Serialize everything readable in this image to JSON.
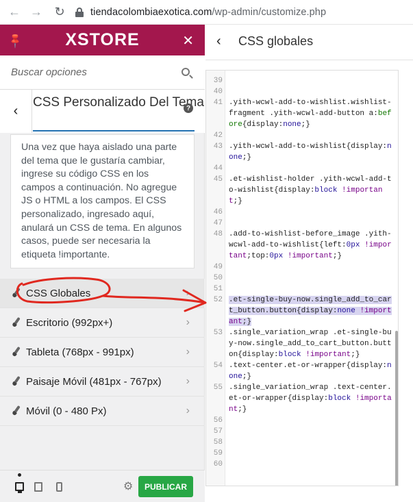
{
  "browser": {
    "url_host": "tiendacolombiaexotica.com",
    "url_path": "/wp-admin/customize.php"
  },
  "left": {
    "logo": "XSTORE",
    "search_placeholder": "Buscar opciones",
    "section_title": "CSS Personalizado Del Tema",
    "description": "Una vez que haya aislado una parte del tema que le gustaría cambiar, ingrese su código CSS en los campos a continuación. No agregue JS o HTML a los campos. El CSS personalizado, ingresado aquí, anulará un CSS de tema. En algunos casos, puede ser necesaria la etiqueta !importante.",
    "menu": [
      {
        "label": "CSS Globales"
      },
      {
        "label": "Escritorio (992px+)"
      },
      {
        "label": "Tableta (768px - 991px)"
      },
      {
        "label": "Paisaje Móvil (481px - 767px)"
      },
      {
        "label": "Móvil (0 - 480 Px)"
      }
    ],
    "publish_label": "PUBLICAR"
  },
  "right": {
    "title": "CSS globales"
  },
  "colors": {
    "brand": "#a3174d",
    "publish": "#28a745",
    "accent": "#2271b1"
  },
  "icons": [
    "pin-icon",
    "close-icon",
    "search-icon",
    "chevron-left-icon",
    "help-icon",
    "brush-icon",
    "chevron-right-icon",
    "desktop-icon",
    "tablet-icon",
    "mobile-icon",
    "gear-icon",
    "lock-icon"
  ]
}
